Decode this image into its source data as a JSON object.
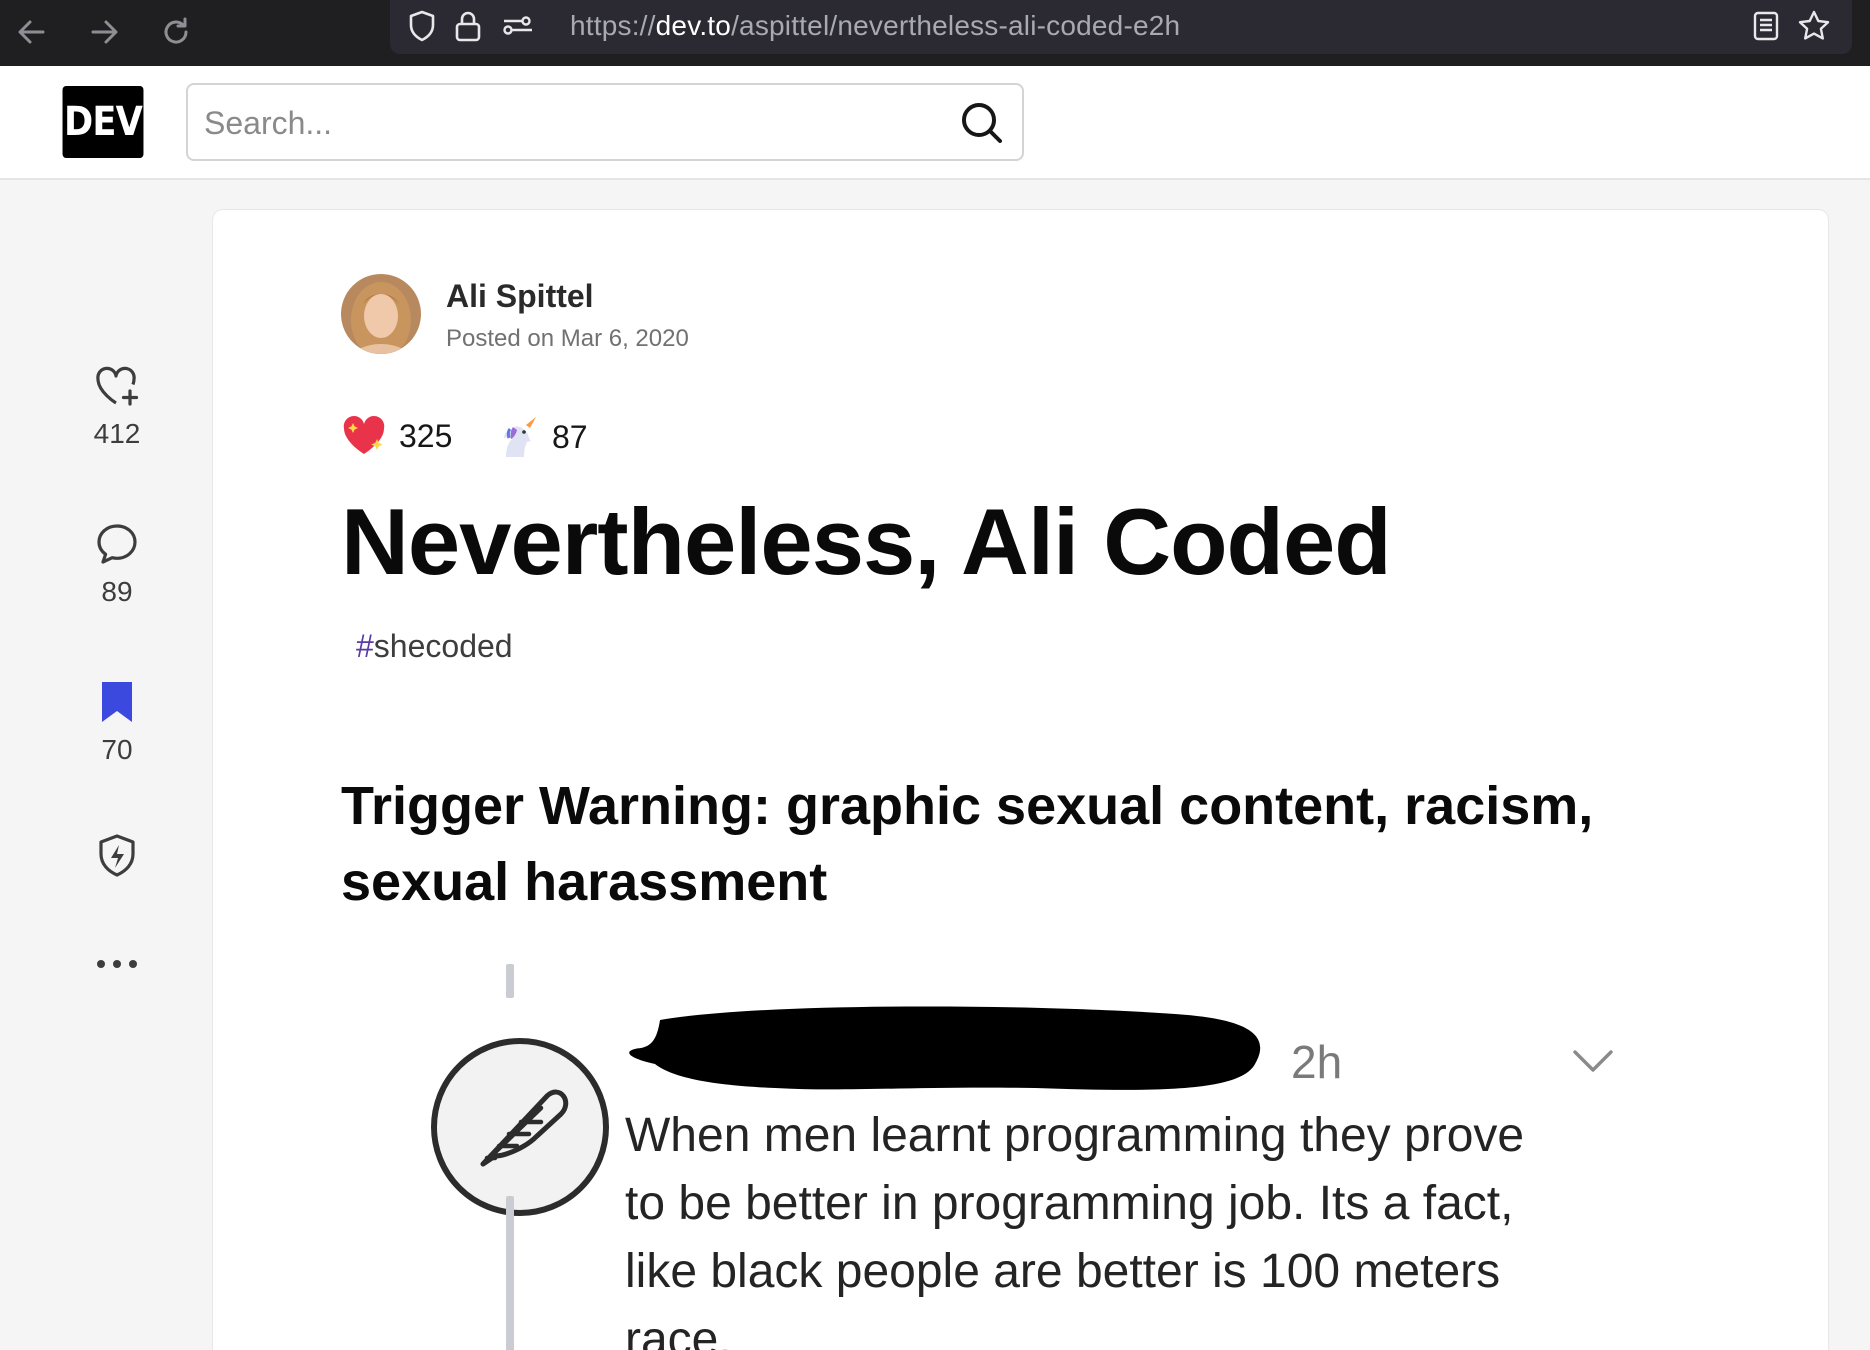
{
  "browser": {
    "url_prefix": "https://",
    "url_host": "dev.to",
    "url_path": "/aspittel/nevertheless-ali-coded-e2h",
    "icons": [
      "back-icon",
      "forward-icon",
      "reload-icon",
      "shield-icon",
      "lock-icon",
      "permissions-icon",
      "reader-mode-icon",
      "bookmark-star-icon"
    ]
  },
  "header": {
    "logo_text": "DEV",
    "search_placeholder": "Search..."
  },
  "rail": {
    "likes": "412",
    "comments": "89",
    "saves": "70",
    "accent_color": "#3b49df"
  },
  "article": {
    "author": "Ali Spittel",
    "posted": "Posted on Mar 6, 2020",
    "reactions": [
      {
        "icon": "sparkle-heart-icon",
        "count": "325"
      },
      {
        "icon": "unicorn-icon",
        "count": "87"
      }
    ],
    "title": "Nevertheless, Ali Coded",
    "tag_hash": "#",
    "tag_name": "shecoded",
    "subheading": "Trigger Warning: graphic sexual content, racism, sexual harassment"
  },
  "embed": {
    "time": "2h",
    "comment": "When men learnt programming they prove to be better in programming job. Its a fact, like black people are better is 100 meters race."
  }
}
